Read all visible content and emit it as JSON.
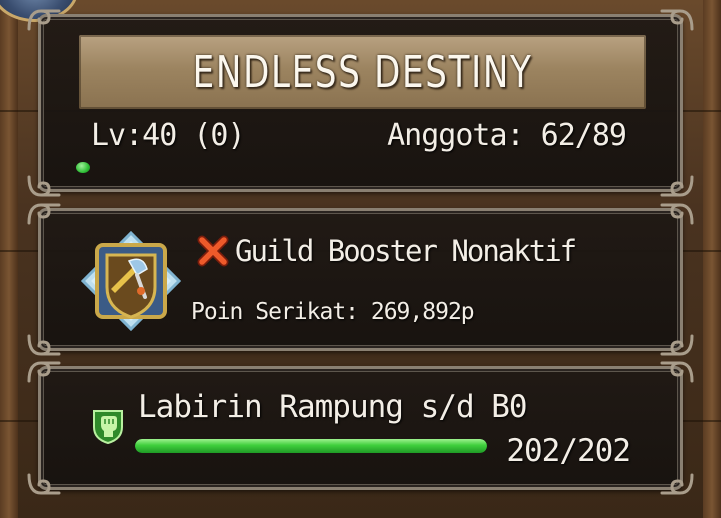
{
  "guild": {
    "name": "ENDLESS DESTINY",
    "level": "Lv:40 (0)",
    "members": "Anggota: 62/89"
  },
  "booster": {
    "status": "Guild Booster Nonaktif",
    "status_icon": "red-x-icon",
    "points": "Poin Serikat: 269,892p",
    "emblem_icon": "guild-shield-emblem-icon"
  },
  "labyrinth": {
    "title": "Labirin Rampung s/d B0",
    "icon": "green-fist-icon",
    "progress_current": 202,
    "progress_max": 202,
    "progress_label": "202/202",
    "progress_color": "#3fcf3c"
  }
}
